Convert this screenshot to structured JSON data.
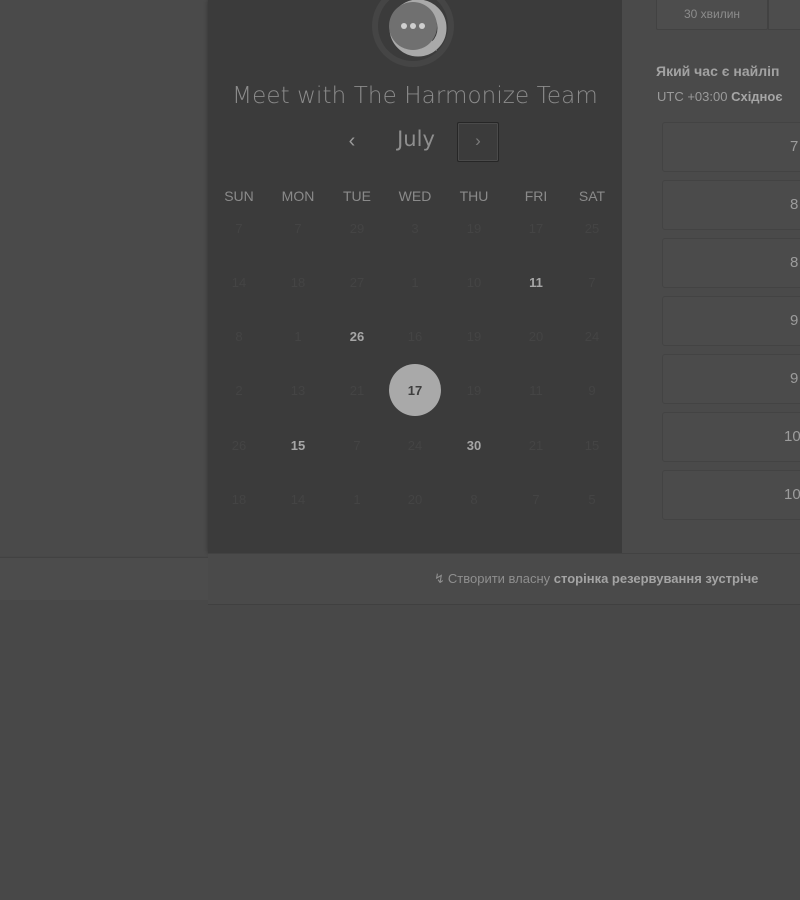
{
  "booking": {
    "title": "Meet with The Harmonize Team",
    "logo_icon": "chat-bubble-logo-icon"
  },
  "calendar": {
    "month": "July",
    "prev_icon": "chevron-left-icon",
    "next_icon": "chevron-right-icon",
    "weekdays": [
      "SUN",
      "MON",
      "TUE",
      "WED",
      "THU",
      "FRI",
      "SAT"
    ],
    "weeks": [
      [
        {
          "d": "7",
          "s": "disabled"
        },
        {
          "d": "7",
          "s": "disabled"
        },
        {
          "d": "29",
          "s": "disabled"
        },
        {
          "d": "3",
          "s": "disabled"
        },
        {
          "d": "19",
          "s": "disabled"
        },
        {
          "d": "17",
          "s": "disabled"
        },
        {
          "d": "25",
          "s": "disabled"
        }
      ],
      [
        {
          "d": "14",
          "s": "disabled"
        },
        {
          "d": "18",
          "s": "disabled"
        },
        {
          "d": "27",
          "s": "disabled"
        },
        {
          "d": "1",
          "s": "disabled"
        },
        {
          "d": "10",
          "s": "disabled"
        },
        {
          "d": "11",
          "s": "available"
        },
        {
          "d": "7",
          "s": "disabled"
        }
      ],
      [
        {
          "d": "8",
          "s": "disabled"
        },
        {
          "d": "1",
          "s": "disabled"
        },
        {
          "d": "26",
          "s": "available"
        },
        {
          "d": "16",
          "s": "disabled"
        },
        {
          "d": "19",
          "s": "disabled"
        },
        {
          "d": "20",
          "s": "disabled"
        },
        {
          "d": "24",
          "s": "disabled"
        }
      ],
      [
        {
          "d": "2",
          "s": "disabled"
        },
        {
          "d": "13",
          "s": "disabled"
        },
        {
          "d": "21",
          "s": "disabled"
        },
        {
          "d": "17",
          "s": "selected"
        },
        {
          "d": "19",
          "s": "disabled"
        },
        {
          "d": "11",
          "s": "disabled"
        },
        {
          "d": "9",
          "s": "disabled"
        }
      ],
      [
        {
          "d": "26",
          "s": "disabled"
        },
        {
          "d": "15",
          "s": "available"
        },
        {
          "d": "7",
          "s": "disabled"
        },
        {
          "d": "24",
          "s": "disabled"
        },
        {
          "d": "30",
          "s": "available"
        },
        {
          "d": "21",
          "s": "disabled"
        },
        {
          "d": "15",
          "s": "disabled"
        }
      ],
      [
        {
          "d": "18",
          "s": "disabled"
        },
        {
          "d": "14",
          "s": "disabled"
        },
        {
          "d": "1",
          "s": "disabled"
        },
        {
          "d": "20",
          "s": "disabled"
        },
        {
          "d": "8",
          "s": "disabled"
        },
        {
          "d": "7",
          "s": "disabled"
        },
        {
          "d": "5",
          "s": "disabled"
        }
      ]
    ]
  },
  "right": {
    "duration_tab": "30 хвилин",
    "question": "Який час є найліп",
    "timezone_offset": "UTC +03:00",
    "timezone_name": "Східноє",
    "time_slots": [
      "7",
      "8",
      "8",
      "9",
      "9",
      "10",
      "10"
    ]
  },
  "footer": {
    "icon": "sparkle-icon",
    "prefix": "Створити власну",
    "link": "сторінка резервування зустрічe"
  }
}
